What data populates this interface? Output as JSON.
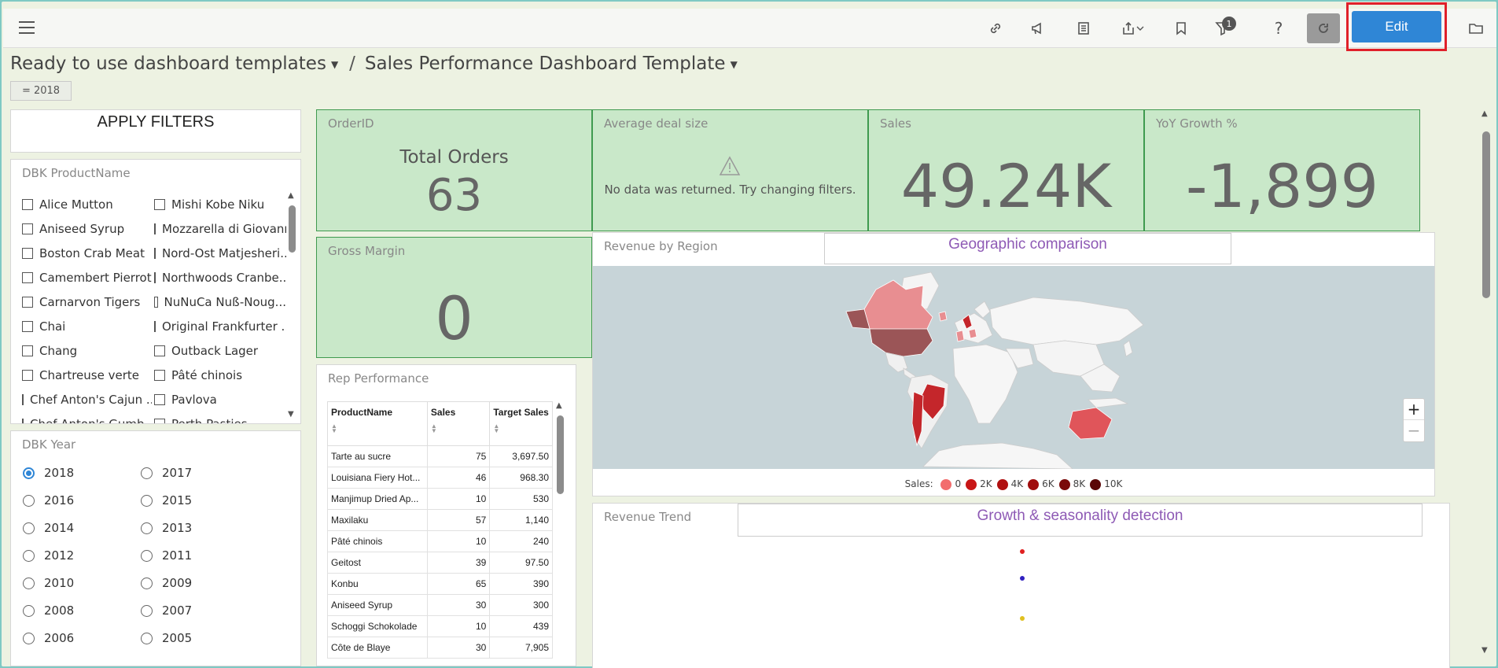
{
  "toolbar": {
    "menu_icon": "hamburger-icon",
    "icons": [
      "link-icon",
      "megaphone-icon",
      "book-icon",
      "share-icon",
      "bookmark-icon",
      "filter-icon",
      "help-icon"
    ],
    "filter_count": "1",
    "edit_label": "Edit",
    "folder_icon": "folder-icon"
  },
  "breadcrumb": {
    "parent": "Ready to use dashboard templates",
    "current": "Sales Performance Dashboard Template"
  },
  "filter_chip": "= 2018",
  "apply_filters": "APPLY FILTERS",
  "product_filter": {
    "title": "DBK ProductName",
    "col1": [
      "Alice Mutton",
      "Aniseed Syrup",
      "Boston Crab Meat",
      "Camembert Pierrot",
      "Carnarvon Tigers",
      "Chai",
      "Chang",
      "Chartreuse verte",
      "Chef Anton's Cajun ...",
      "Chef Anton's Gumb..."
    ],
    "col2": [
      "Mishi Kobe Niku",
      "Mozzarella di Giovanni",
      "Nord-Ost Matjesheri...",
      "Northwoods Cranbe...",
      "NuNuCa Nuß-Noug...",
      "Original Frankfurter ...",
      "Outback Lager",
      "Pâté chinois",
      "Pavlova",
      "Perth Pasties"
    ]
  },
  "year_filter": {
    "title": "DBK Year",
    "years": [
      "2018",
      "2017",
      "2016",
      "2015",
      "2014",
      "2013",
      "2012",
      "2011",
      "2010",
      "2009",
      "2008",
      "2007",
      "2006",
      "2005"
    ],
    "selected": "2018"
  },
  "kpis": {
    "orders": {
      "title": "OrderID",
      "subtitle": "Total Orders",
      "value": "63"
    },
    "deal": {
      "title": "Average deal size",
      "message": "No data was returned. Try changing filters.",
      "icon": "warning-icon"
    },
    "sales": {
      "title": "Sales",
      "value": "49.24K"
    },
    "yoy": {
      "title": "YoY Growth %",
      "value": "-1,899"
    },
    "margin": {
      "title": "Gross Margin",
      "value": "0"
    }
  },
  "rep_performance": {
    "title": "Rep Performance",
    "columns": [
      "ProductName",
      "Sales",
      "Target Sales"
    ],
    "rows": [
      [
        "Tarte au sucre",
        "75",
        "3,697.50"
      ],
      [
        "Louisiana Fiery Hot...",
        "46",
        "968.30"
      ],
      [
        "Manjimup Dried Ap...",
        "10",
        "530"
      ],
      [
        "Maxilaku",
        "57",
        "1,140"
      ],
      [
        "Pâté chinois",
        "10",
        "240"
      ],
      [
        "Geitost",
        "39",
        "97.50"
      ],
      [
        "Konbu",
        "65",
        "390"
      ],
      [
        "Aniseed Syrup",
        "30",
        "300"
      ],
      [
        "Schoggi Schokolade",
        "10",
        "439"
      ],
      [
        "Côte de Blaye",
        "30",
        "7,905"
      ]
    ]
  },
  "map": {
    "title": "Revenue by Region",
    "overlay": "Geographic comparison",
    "zoom_in": "+",
    "zoom_out": "−",
    "legend_label": "Sales:",
    "legend": [
      {
        "label": "0",
        "color": "#f26d6d"
      },
      {
        "label": "2K",
        "color": "#c81616"
      },
      {
        "label": "4K",
        "color": "#b01010"
      },
      {
        "label": "6K",
        "color": "#a00c0c"
      },
      {
        "label": "8K",
        "color": "#7a0a0a"
      },
      {
        "label": "10K",
        "color": "#5a0606"
      }
    ]
  },
  "trend": {
    "title": "Revenue Trend",
    "overlay": "Growth & seasonality detection",
    "dot_colors": [
      "#e02020",
      "#3020c0",
      "#e0c020"
    ]
  }
}
